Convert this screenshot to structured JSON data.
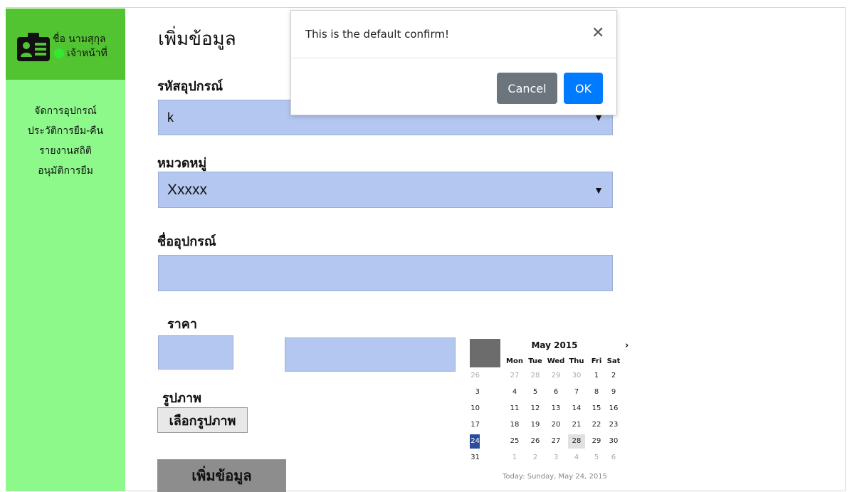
{
  "sidebar": {
    "user": {
      "name": "ชื่อ นามสุกุล",
      "role": "เจ้าหน้าที่",
      "status_color": "#33e833"
    },
    "menu": [
      {
        "label": "จัดการอุปกรณ์"
      },
      {
        "label": "ประวัติการยืม-คืน"
      },
      {
        "label": "รายงานสถิติ"
      },
      {
        "label": "อนุมัติการยืม"
      }
    ],
    "colors": {
      "header_bg": "#52c431",
      "menu_bg": "#8cf98a"
    }
  },
  "form": {
    "title": "เพิ่มข้อมูล",
    "equipment_code_label": "รหัสอุปกรณ์",
    "equipment_code_value": "k",
    "category_label": "หมวดหมู่",
    "category_value": "Xxxxx",
    "equipment_name_label": "ชื่ออุปกรณ์",
    "equipment_name_value": "",
    "price_label": "ราคา",
    "price_value": "",
    "date_value": "",
    "image_label": "รูปภาพ",
    "choose_image_button": "เลือกรูปภาพ",
    "submit_button": "เพิ่มข้อมูล",
    "field_color": "#b4c7f0"
  },
  "datepicker": {
    "month_label": "May 2015",
    "next_icon": "chevron-right",
    "weekdays": [
      "Mon",
      "Tue",
      "Wed",
      "Thu",
      "Fri",
      "Sat"
    ],
    "weeks": [
      [
        "26",
        "27",
        "28",
        "29",
        "30",
        "1",
        "2"
      ],
      [
        "3",
        "4",
        "5",
        "6",
        "7",
        "8",
        "9"
      ],
      [
        "10",
        "11",
        "12",
        "13",
        "14",
        "15",
        "16"
      ],
      [
        "17",
        "18",
        "19",
        "20",
        "21",
        "22",
        "23"
      ],
      [
        "24",
        "25",
        "26",
        "27",
        "28",
        "29",
        "30"
      ],
      [
        "31",
        "1",
        "2",
        "3",
        "4",
        "5",
        "6"
      ]
    ],
    "footer": "Today: Sunday, May 24, 2015",
    "today": "24",
    "highlighted": "28"
  },
  "modal": {
    "message": "This is the default confirm!",
    "close_icon": "close-icon",
    "cancel_label": "Cancel",
    "ok_label": "OK",
    "ok_color": "#007bff",
    "cancel_color": "#6c757d"
  }
}
